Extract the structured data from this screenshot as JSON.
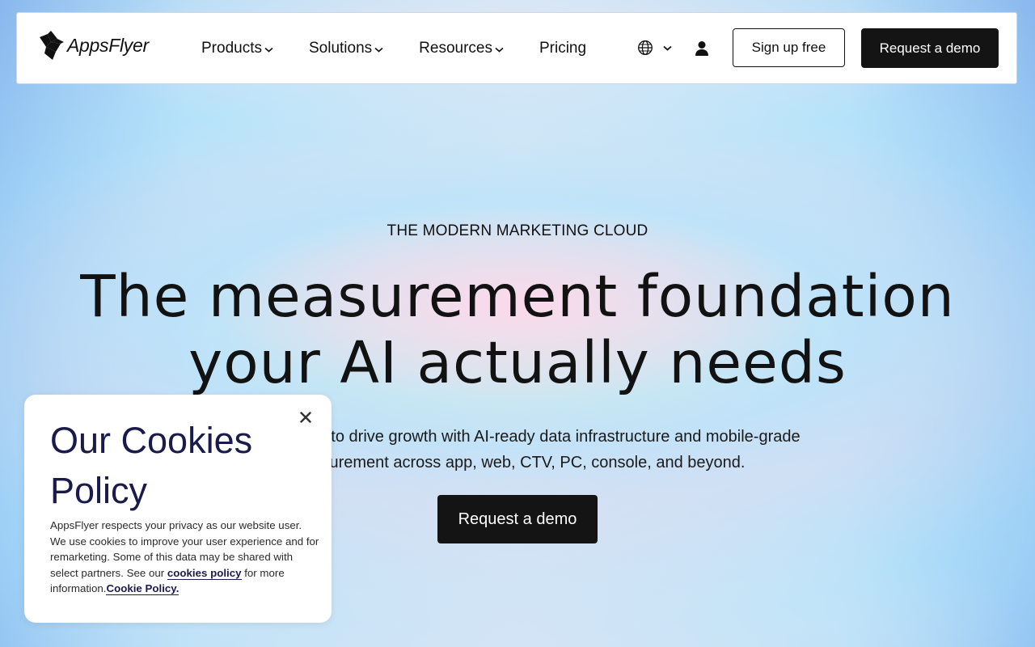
{
  "header": {
    "logo_text": "AppsFlyer",
    "nav": [
      {
        "label": "Products",
        "has_dropdown": true
      },
      {
        "label": "Solutions",
        "has_dropdown": true
      },
      {
        "label": "Resources",
        "has_dropdown": true
      },
      {
        "label": "Pricing",
        "has_dropdown": false
      }
    ],
    "language_icon": "globe-icon",
    "account_icon": "user-icon",
    "signup_label": "Sign up free",
    "demo_label": "Request a demo"
  },
  "hero": {
    "eyebrow": "THE MODERN MARKETING CLOUD",
    "headline_line1": "The measurement foundation",
    "headline_line2": "your AI actually needs",
    "subtext_line1": "Unify signals to drive growth with AI-ready data infrastructure and mobile-grade",
    "subtext_line2": "measurement across app, web, CTV, PC, console, and beyond.",
    "cta_label": "Request a demo"
  },
  "cookie_banner": {
    "title": "Our Cookies Policy",
    "body_text": "AppsFlyer respects your privacy as our website user. We use cookies to improve your user experience and for remarketing. Some of this data may be shared with select partners. See our ",
    "cookies_link": "cookies policy",
    "body_text_2": " for more information.",
    "policy_link": "Cookie Policy.",
    "close_icon": "close-icon"
  },
  "colors": {
    "header_bg": "#ffffff",
    "button_dark": "#141414",
    "cookie_title": "#1a1b4b",
    "text": "#111111"
  }
}
